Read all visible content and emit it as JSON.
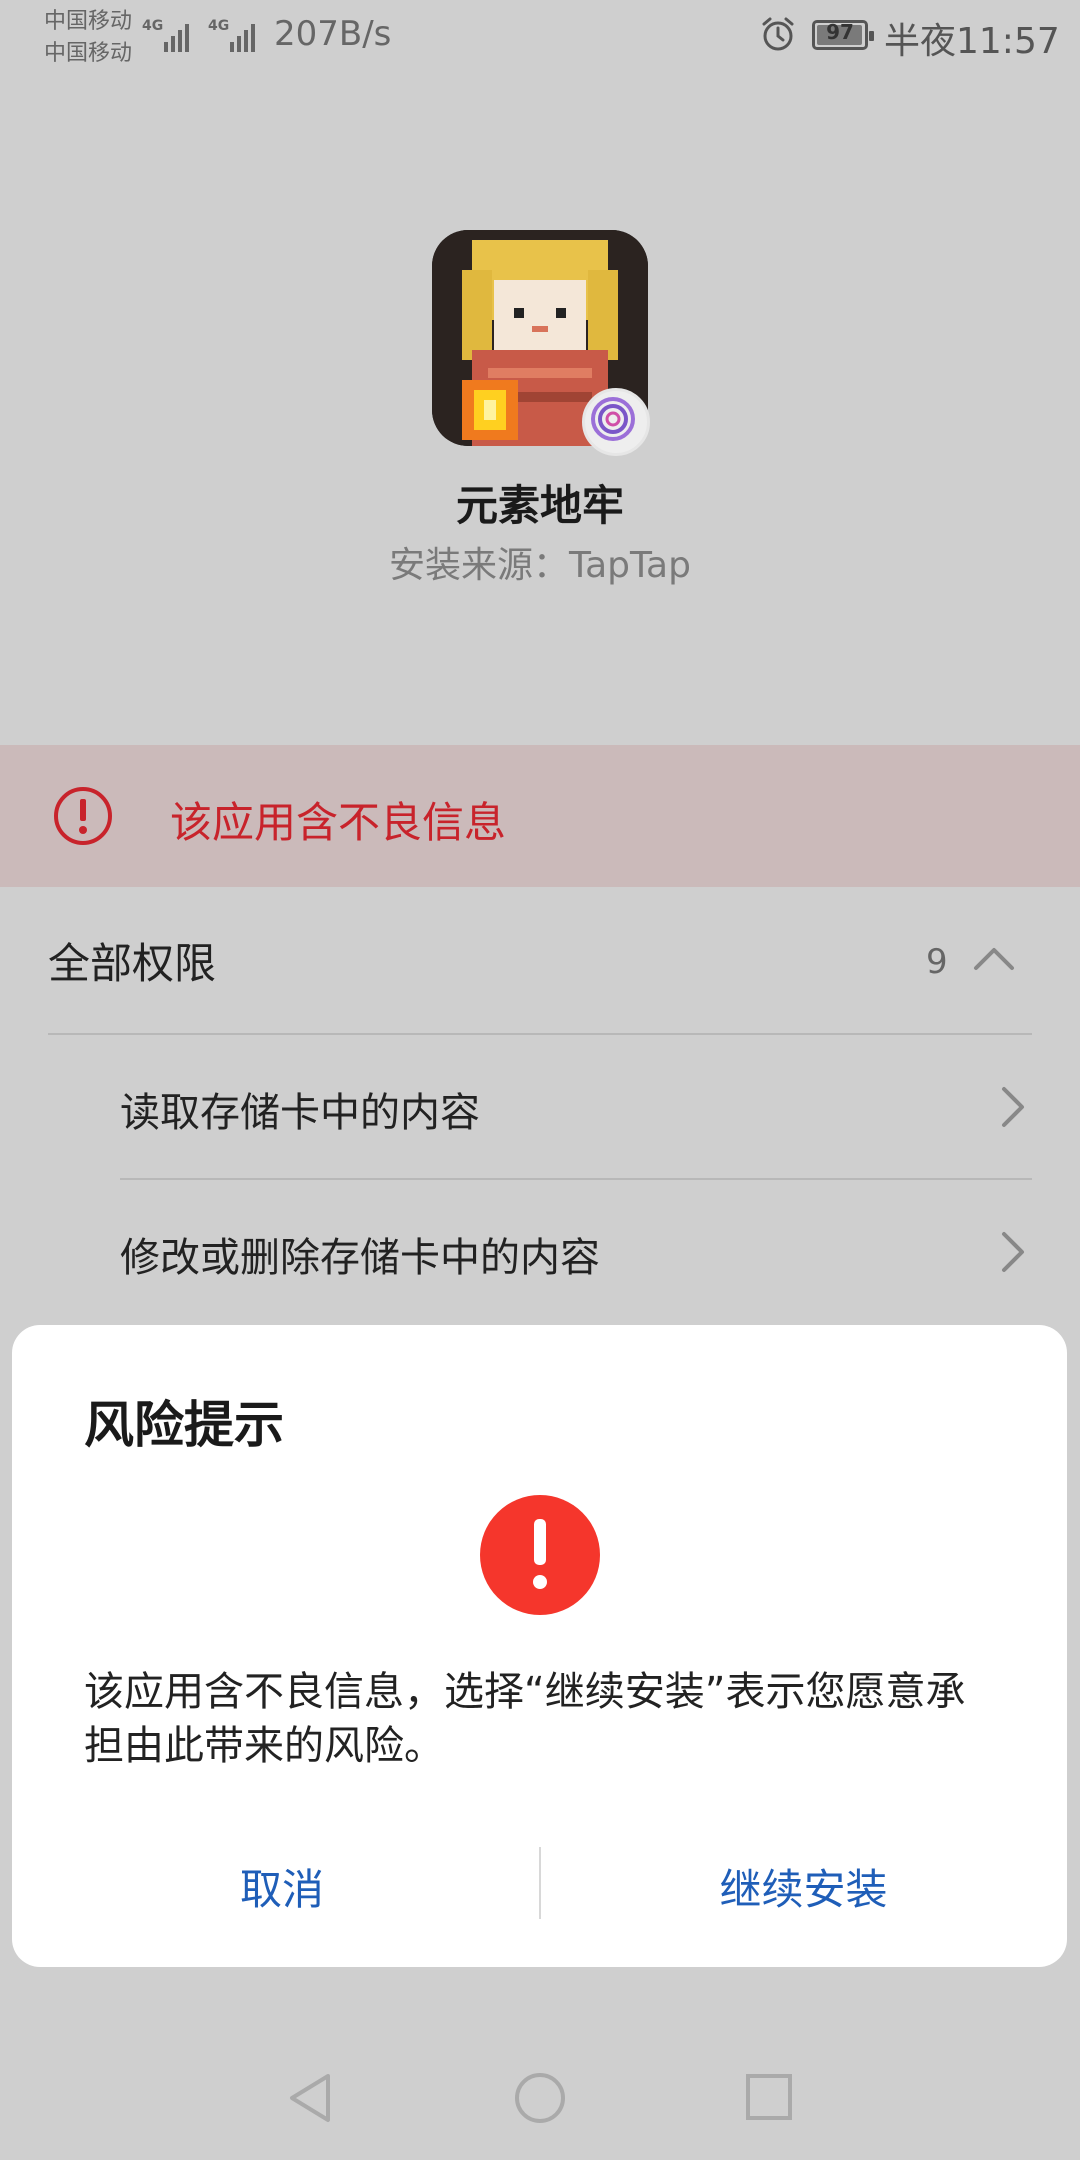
{
  "status_bar": {
    "carrier_1": "中国移动",
    "carrier_2": "中国移动",
    "signal_1_label": "4G",
    "signal_2_label": "4G",
    "net_speed": "207B/s",
    "battery": "97",
    "battery_level": 0.97,
    "time": "半夜11:57",
    "icons": [
      "signal-icon",
      "alarm-icon",
      "battery-icon"
    ]
  },
  "app": {
    "name": "元素地牢",
    "install_source": "安装来源：TapTap",
    "badge_icon": "tap-source-icon"
  },
  "warning": {
    "text": "该应用含不良信息",
    "color": "#c8232b",
    "icon": "exclamation-circle-icon"
  },
  "permissions": {
    "header": "全部权限",
    "count": "9",
    "items": [
      {
        "label": "读取存储卡中的内容"
      },
      {
        "label": "修改或删除存储卡中的内容"
      }
    ]
  },
  "dialog": {
    "title": "风险提示",
    "message": "该应用含不良信息，选择“继续安装”表示您愿意承担由此带来的风险。",
    "cancel_label": "取消",
    "continue_label": "继续安装",
    "icon_color": "#f5362c",
    "button_color": "#1f5eb8"
  },
  "nav_bar": {
    "icons": [
      "back-icon",
      "home-icon",
      "recents-icon"
    ]
  }
}
